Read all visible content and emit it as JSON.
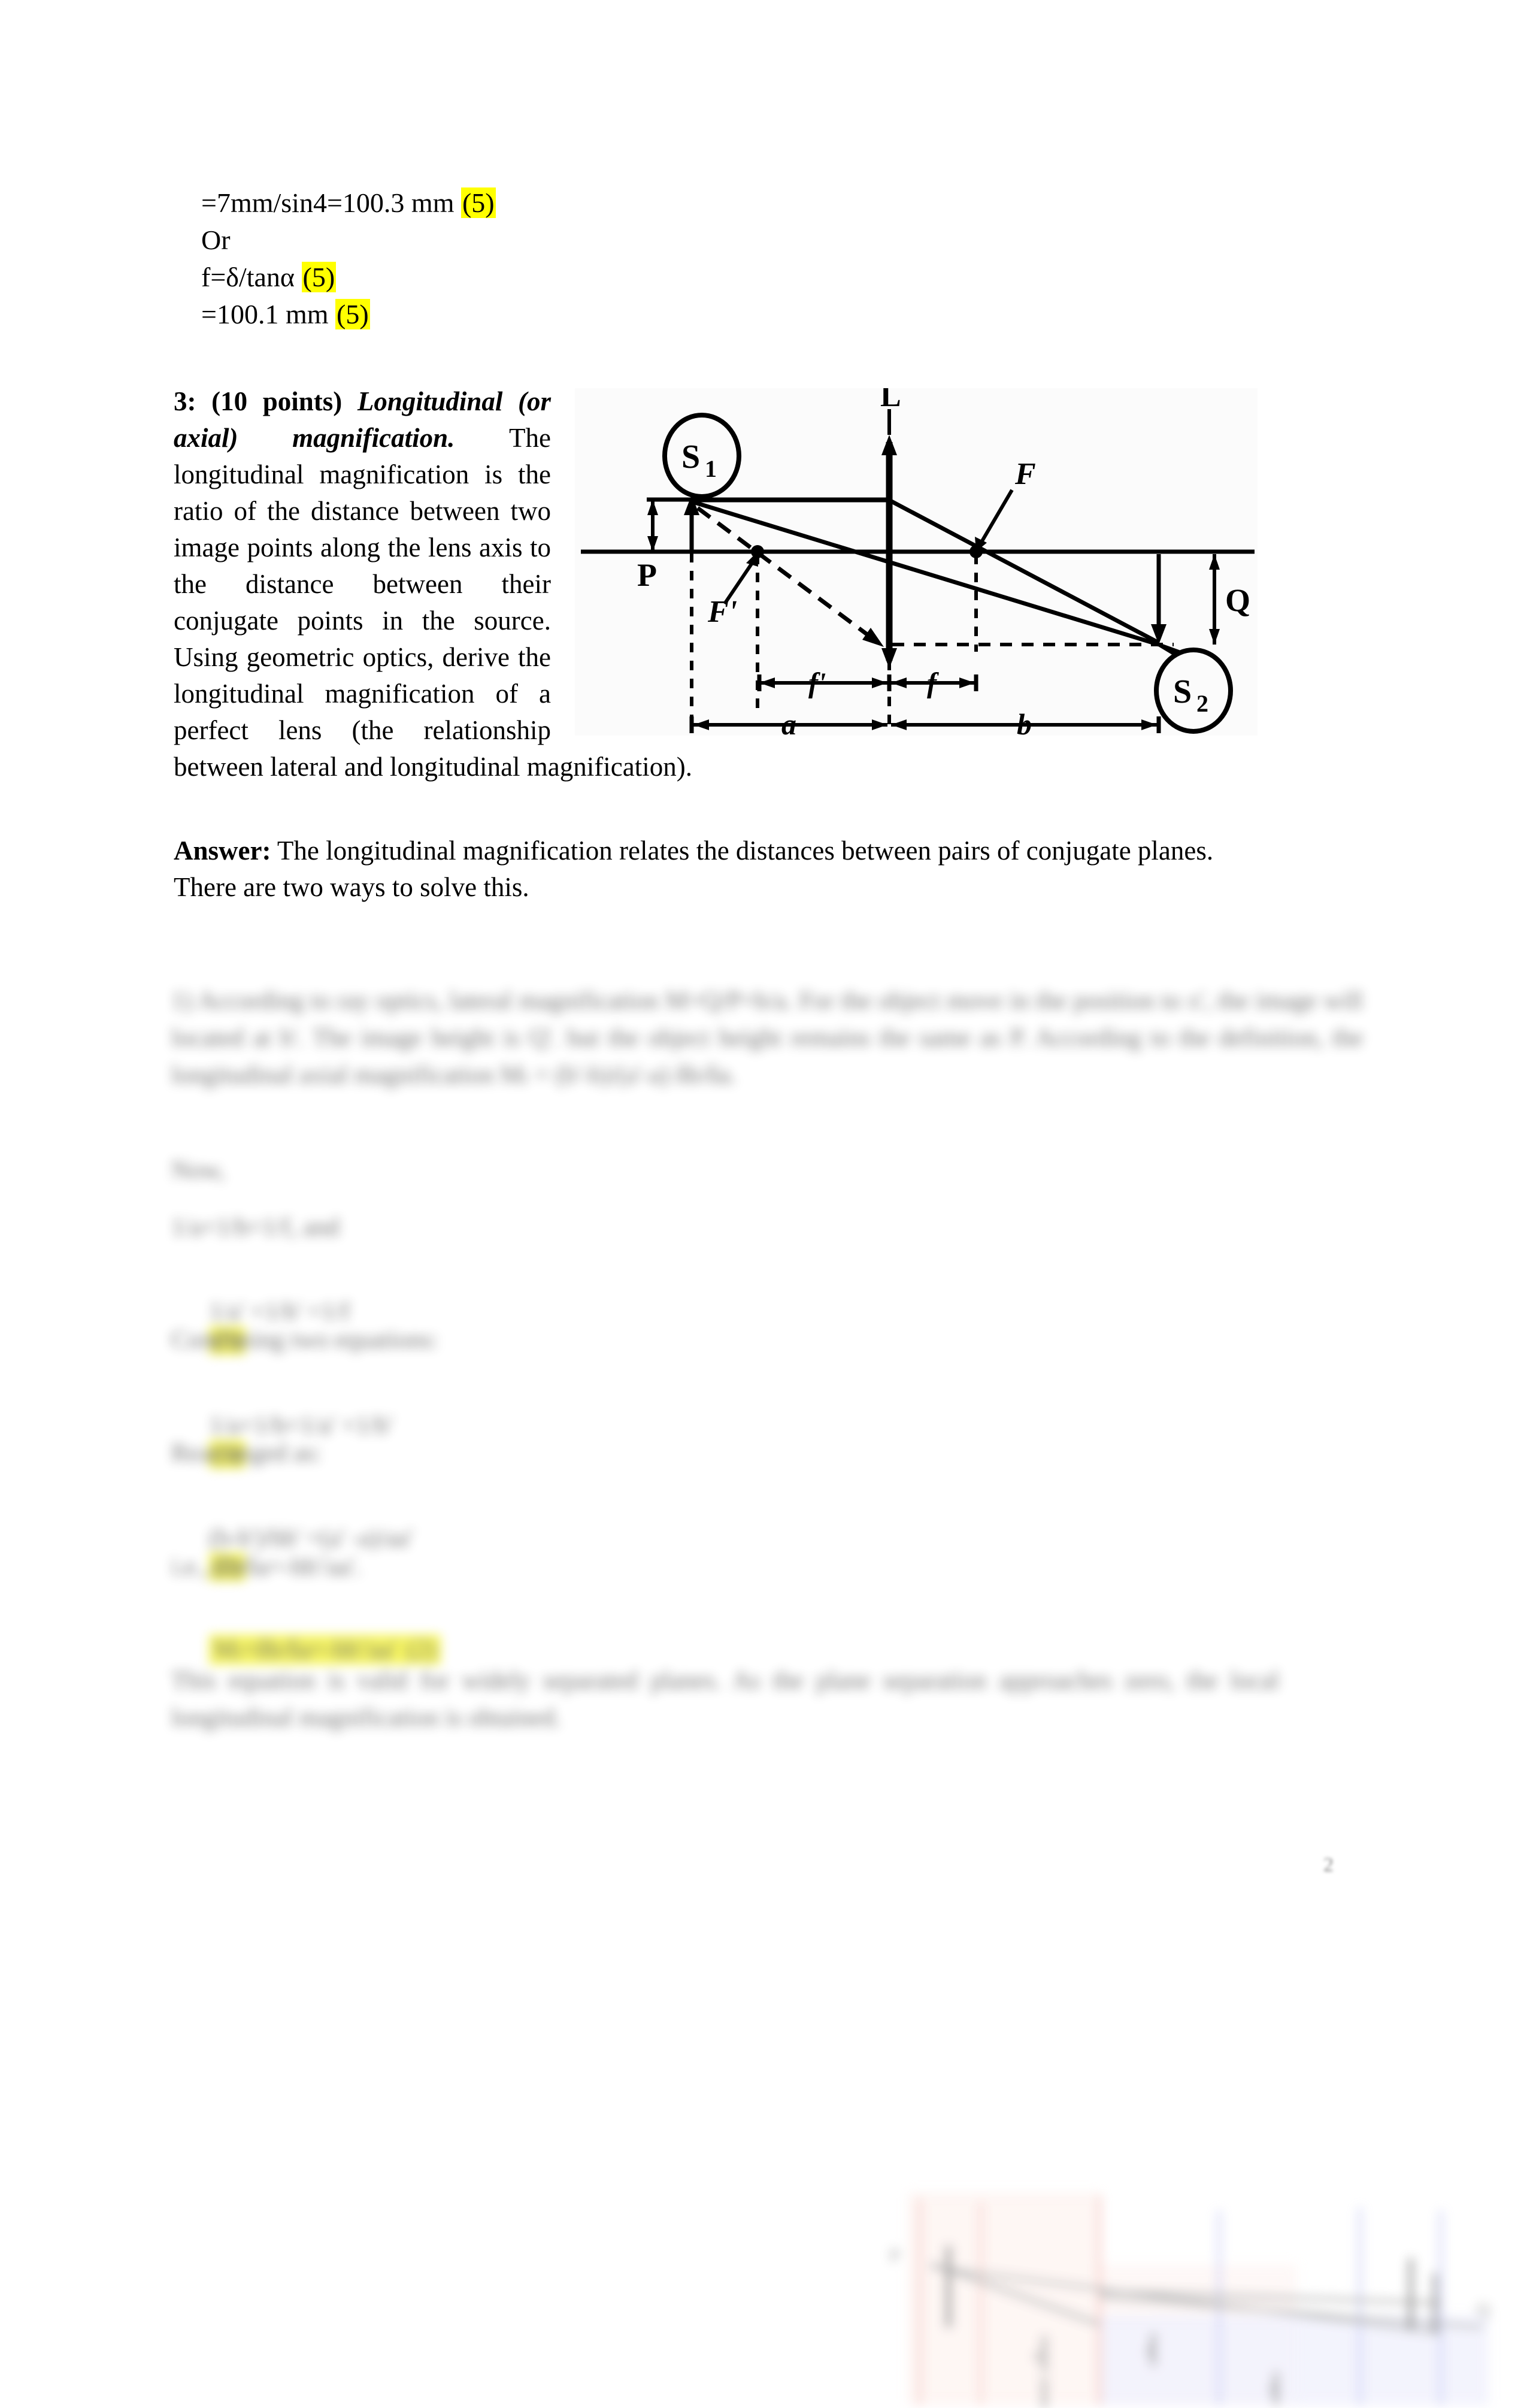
{
  "top_lines": [
    {
      "text": "=7mm/sin4=100.3 mm ",
      "mark": "(5)"
    },
    {
      "text": "Or",
      "mark": ""
    },
    {
      "text": "f=δ/tanα ",
      "mark": "(5)"
    },
    {
      "text": "=100.1 mm ",
      "mark": "(5)"
    }
  ],
  "question": {
    "number": "3:",
    "points": "(10 points)",
    "title_italic": "Longitudinal (or axial) magnification.",
    "body": "The longitudinal magnification is the ratio of the distance between two image points along the lens axis to the distance between their conjugate points in the source. Using geometric optics, derive the longitudinal magnification of a perfect lens (the relationship between lateral and longitudinal magnification)."
  },
  "figure": {
    "caption": "",
    "labels": {
      "source_point": "S",
      "source_sub": "1",
      "image_point": "S",
      "image_sub": "2",
      "lens": "L",
      "focal_right": "F",
      "focal_left": "F'",
      "object_height": "P",
      "image_height": "Q",
      "focal_len_left": "f'",
      "focal_len_right": "f",
      "object_dist": "a",
      "image_dist": "b"
    }
  },
  "answer": {
    "lead": "Answer:",
    "text": " The longitudinal magnification relates the distances between pairs of conjugate planes. There are two ways to solve this."
  },
  "solution": {
    "redacted": true,
    "paragraph_1": "1) According to ray optics, lateral magnification M=Q/P=b/a. For the object move in the position to x', the image will located at b'. The image height is Q'. but the object height remains the same as P. According to the definition, the longitudinal axial magnification Mₗ = (b'-b)/(a'-a)  δb/δa.",
    "line_now": "Now,",
    "line_1": "1/a+1/b=1/f, and",
    "line_2": "1/a' +1/b' =1/f",
    "line_2_mark": "(3)",
    "line_combine": "Combining two equations:",
    "line_3": "1/a+1/b=1/a' +1/b'",
    "line_3_mark": "(3)",
    "line_rearrange": "Rearranged as:",
    "line_4": "(b-b')/bb' =(a' -a)/aa'",
    "line_4_mark": "(2)",
    "line_5": "i.e., δb/δa=-bb'/aa'.",
    "line_highlight": "Mₗ=δb/δa=-bb'/aa'",
    "line_highlight_mark": "(2)",
    "closing": "This equation is valid for widely separated planes. As the plane separation approaches zero, the local longitudinal magnification is obtained."
  },
  "page_number": "2",
  "colors": {
    "highlight": "#ffff00",
    "ink": "#000000",
    "figure_bg": "#fbfbfb",
    "blur_red": "#f5b6b0",
    "blur_blue": "#b9bdf0",
    "blur_gray": "#9a9a9a"
  }
}
